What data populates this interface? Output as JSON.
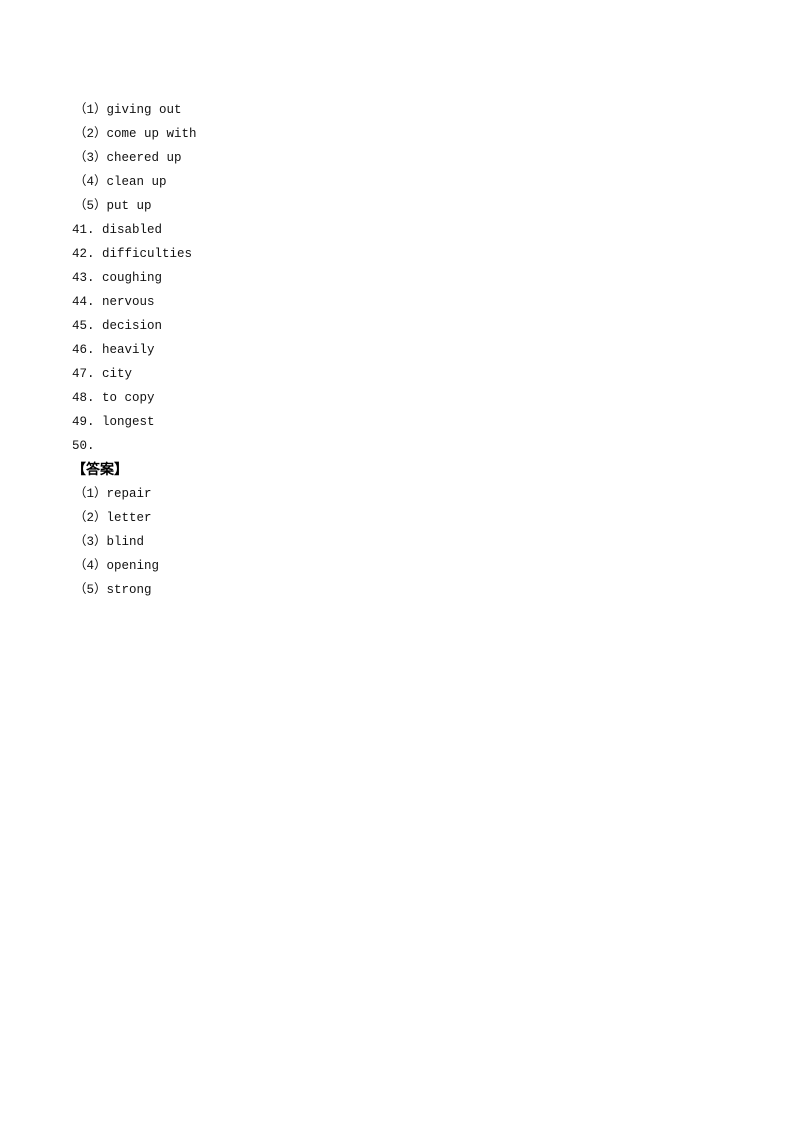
{
  "section1": {
    "items": [
      "（1）giving out",
      "（2）come up with",
      "（3）cheered up",
      "（4）clean up",
      "（5）put up"
    ]
  },
  "section2": {
    "items": [
      "41. disabled",
      "42. difficulties",
      "43. coughing",
      "44. nervous",
      "45. decision",
      "46. heavily",
      "47. city",
      "48. to copy",
      "49. longest",
      "50."
    ]
  },
  "answer_heading": "【答案】",
  "section3": {
    "items": [
      "（1）repair",
      "（2）letter",
      "（3）blind",
      "（4）opening",
      "（5）strong"
    ]
  }
}
